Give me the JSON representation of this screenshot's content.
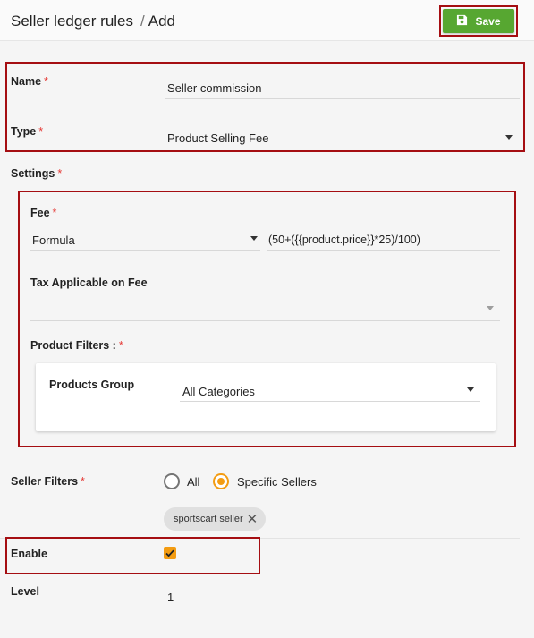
{
  "header": {
    "title": "Seller ledger rules",
    "separator": "/",
    "subtitle": "Add",
    "save_label": "Save",
    "save_color": "#57a731"
  },
  "form": {
    "name": {
      "label": "Name",
      "required": "*",
      "value": "Seller commission"
    },
    "type": {
      "label": "Type",
      "required": "*",
      "value": "Product Selling Fee"
    },
    "settings": {
      "label": "Settings",
      "required": "*",
      "fee": {
        "label": "Fee",
        "required": "*",
        "method": "Formula",
        "formula": "(50+({{product.price}}*25)/100)"
      },
      "tax": {
        "label": "Tax Applicable on Fee",
        "value": ""
      },
      "product_filters": {
        "label": "Product Filters :",
        "required": "*",
        "products_group": {
          "label": "Products Group",
          "value": "All Categories"
        }
      }
    },
    "seller_filters": {
      "label": "Seller Filters",
      "required": "*",
      "options": [
        "All",
        "Specific Sellers"
      ],
      "selected": "Specific Sellers",
      "chips": [
        "sportscart seller"
      ]
    },
    "enable": {
      "label": "Enable",
      "checked": true
    },
    "level": {
      "label": "Level",
      "value": "1"
    }
  },
  "colors": {
    "highlight": "#a50e12",
    "accent": "#f39c12",
    "required": "#e53935"
  },
  "icons": {
    "save": "floppy-disk-icon",
    "dropdown": "caret-down-icon",
    "chip_remove": "close-icon",
    "check": "check-icon"
  }
}
